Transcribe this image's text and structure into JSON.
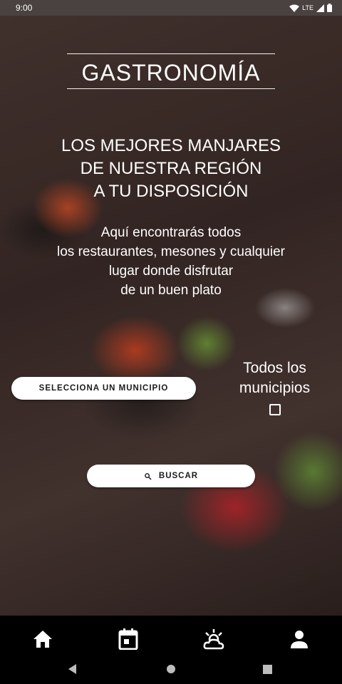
{
  "status_bar": {
    "time": "9:00",
    "network": "LTE"
  },
  "header": {
    "title": "GASTRONOMÍA"
  },
  "hero": {
    "headline_lines": [
      "LOS MEJORES MANJARES",
      "DE NUESTRA REGIÓN",
      "A TU DISPOSICIÓN"
    ],
    "description_lines": [
      "Aquí encontrarás todos",
      "los restaurantes, mesones y cualquier",
      "lugar donde disfrutar",
      "de un buen plato"
    ]
  },
  "filters": {
    "select_label": "SELECCIONA UN MUNICIPIO",
    "all_label_lines": [
      "Todos los",
      "municipios"
    ],
    "all_checked": false
  },
  "search": {
    "label": "BUSCAR",
    "icon": "search-icon"
  },
  "bottom_nav": [
    {
      "name": "home",
      "icon": "home-icon"
    },
    {
      "name": "calendar",
      "icon": "calendar-icon"
    },
    {
      "name": "weather",
      "icon": "weather-icon"
    },
    {
      "name": "profile",
      "icon": "person-icon"
    }
  ],
  "system_nav": [
    "back",
    "home",
    "recents"
  ]
}
